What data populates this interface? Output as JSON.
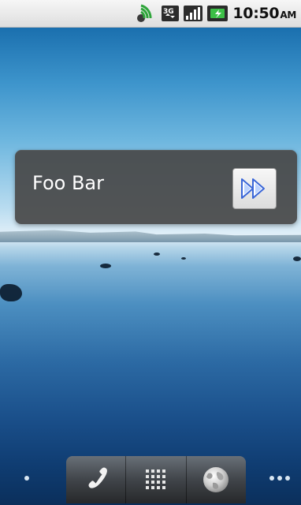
{
  "status_bar": {
    "time": "10:50",
    "ampm": "AM",
    "icons": [
      "sync-icon",
      "3g-data-icon",
      "signal-strength-icon",
      "battery-icon"
    ]
  },
  "widget": {
    "label": "Foo Bar",
    "button_icon": "fast-forward-icon"
  },
  "dock": {
    "items": [
      "phone-icon",
      "app-drawer-icon",
      "browser-icon"
    ]
  }
}
